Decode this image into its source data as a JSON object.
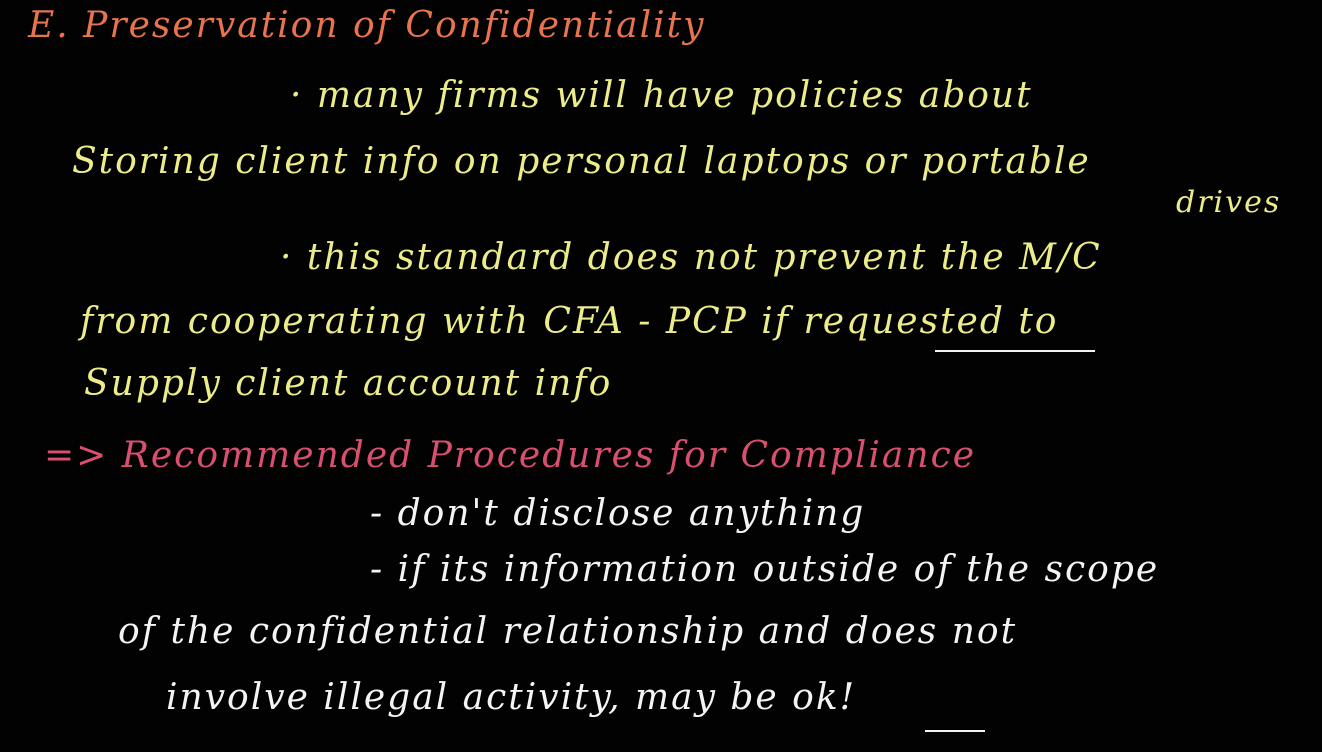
{
  "notes": {
    "heading": "E. Preservation of Confidentiality",
    "bullet1_line1": "· many firms will have policies about",
    "bullet1_line2": "Storing client info on personal laptops or portable",
    "bullet1_line3": "drives",
    "bullet2_line1": "· this standard does not prevent the M/C",
    "bullet2_line2": "from cooperating with CFA - PCP if requested to",
    "bullet2_line3": "Supply client account info",
    "procedures_heading": "=> Recommended Procedures for Compliance",
    "proc_line1": "- don't disclose anything",
    "proc_line2": "- if its information outside of the scope",
    "proc_line3": "of the confidential relationship and does not",
    "proc_line4": "involve illegal activity, may be ok!"
  },
  "colors": {
    "background": "#020202",
    "heading": "#e8734f",
    "body_text": "#ecec8a",
    "procedures_heading": "#d9506f",
    "procedures_text": "#f4f4f4"
  }
}
